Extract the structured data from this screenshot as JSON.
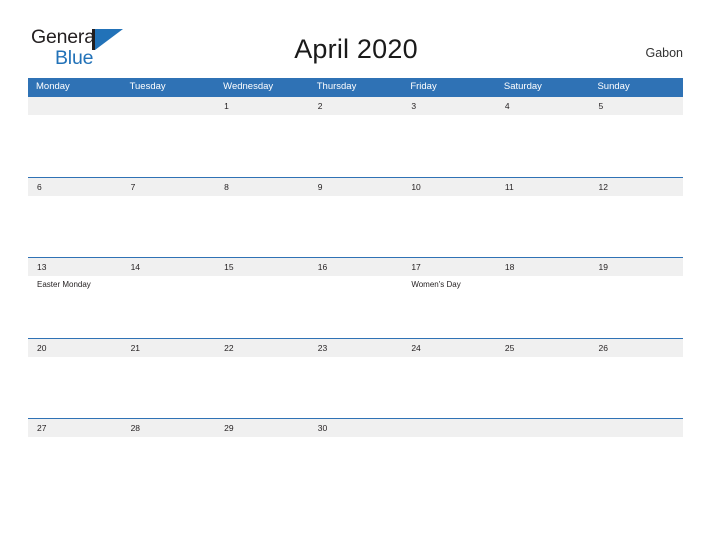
{
  "brand": {
    "name_part1": "General",
    "name_part2": "Blue",
    "mark": "triangle-logo-mark",
    "color_black": "#231f20",
    "color_blue": "#2272b8"
  },
  "header": {
    "title": "April 2020",
    "locale": "Gabon"
  },
  "theme": {
    "header_blue": "#2f72b5",
    "stripe_gray": "#f0f0f0",
    "text_dark": "#231f20",
    "background": "#ffffff"
  },
  "calendar": {
    "month": "April",
    "year": "2020",
    "country": "Gabon",
    "weekdays": [
      "Monday",
      "Tuesday",
      "Wednesday",
      "Thursday",
      "Friday",
      "Saturday",
      "Sunday"
    ],
    "weeks": [
      {
        "days": [
          {
            "num": "",
            "event": ""
          },
          {
            "num": "",
            "event": ""
          },
          {
            "num": "1",
            "event": ""
          },
          {
            "num": "2",
            "event": ""
          },
          {
            "num": "3",
            "event": ""
          },
          {
            "num": "4",
            "event": ""
          },
          {
            "num": "5",
            "event": ""
          }
        ]
      },
      {
        "days": [
          {
            "num": "6",
            "event": ""
          },
          {
            "num": "7",
            "event": ""
          },
          {
            "num": "8",
            "event": ""
          },
          {
            "num": "9",
            "event": ""
          },
          {
            "num": "10",
            "event": ""
          },
          {
            "num": "11",
            "event": ""
          },
          {
            "num": "12",
            "event": ""
          }
        ]
      },
      {
        "days": [
          {
            "num": "13",
            "event": "Easter Monday"
          },
          {
            "num": "14",
            "event": ""
          },
          {
            "num": "15",
            "event": ""
          },
          {
            "num": "16",
            "event": ""
          },
          {
            "num": "17",
            "event": "Women's Day"
          },
          {
            "num": "18",
            "event": ""
          },
          {
            "num": "19",
            "event": ""
          }
        ]
      },
      {
        "days": [
          {
            "num": "20",
            "event": ""
          },
          {
            "num": "21",
            "event": ""
          },
          {
            "num": "22",
            "event": ""
          },
          {
            "num": "23",
            "event": ""
          },
          {
            "num": "24",
            "event": ""
          },
          {
            "num": "25",
            "event": ""
          },
          {
            "num": "26",
            "event": ""
          }
        ]
      },
      {
        "days": [
          {
            "num": "27",
            "event": ""
          },
          {
            "num": "28",
            "event": ""
          },
          {
            "num": "29",
            "event": ""
          },
          {
            "num": "30",
            "event": ""
          },
          {
            "num": "",
            "event": ""
          },
          {
            "num": "",
            "event": ""
          },
          {
            "num": "",
            "event": ""
          }
        ]
      }
    ]
  }
}
